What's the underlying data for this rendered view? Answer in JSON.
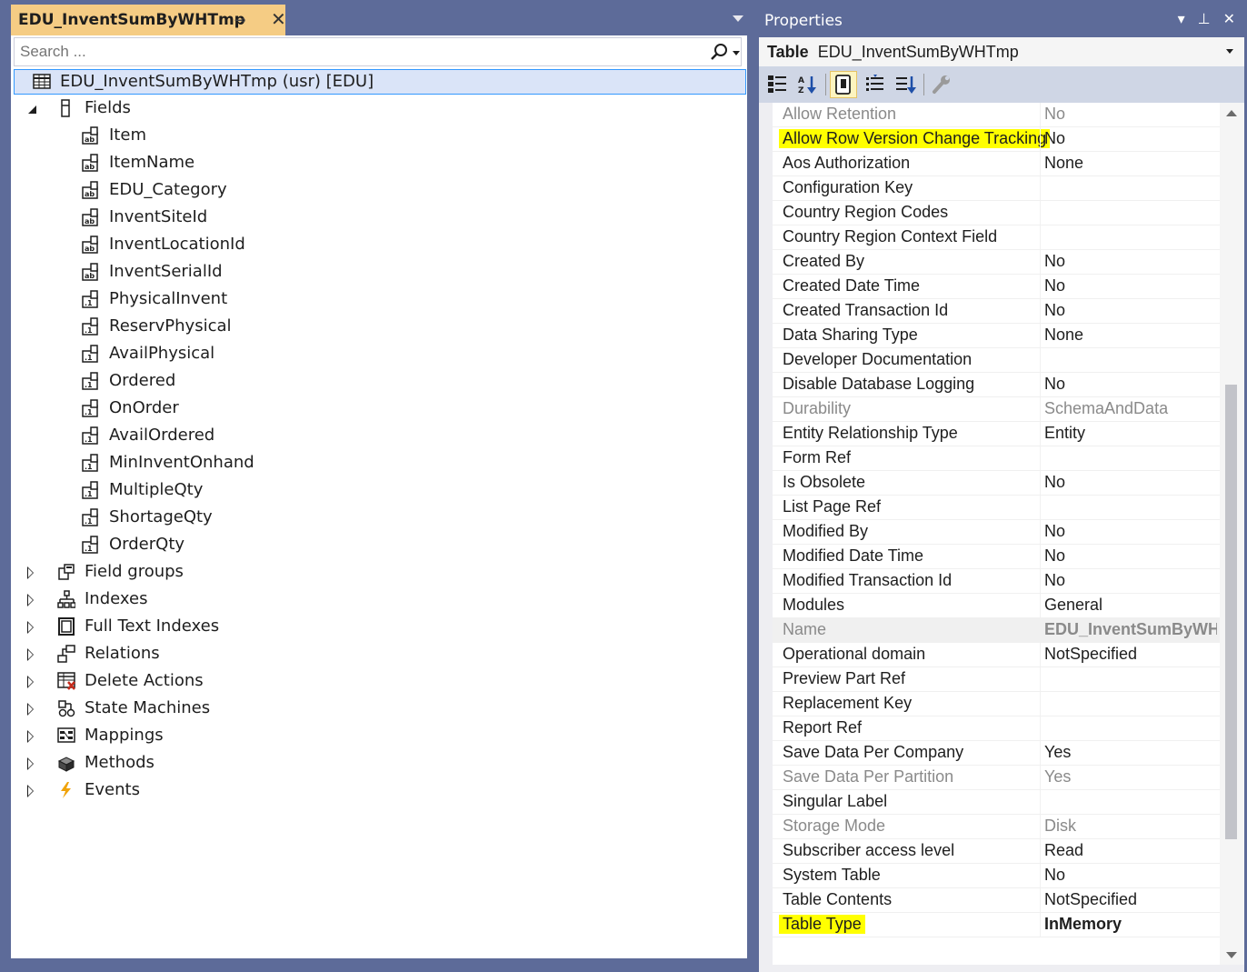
{
  "document_tab": {
    "title": "EDU_InventSumByWHTmp"
  },
  "search": {
    "placeholder": "Search ..."
  },
  "tree": {
    "root_label": "EDU_InventSumByWHTmp (usr) [EDU]",
    "fields_label": "Fields",
    "fields": [
      "Item",
      "ItemName",
      "EDU_Category",
      "InventSiteId",
      "InventLocationId",
      "InventSerialId",
      "PhysicalInvent",
      "ReservPhysical",
      "AvailPhysical",
      "Ordered",
      "OnOrder",
      "AvailOrdered",
      "MinInventOnhand",
      "MultipleQty",
      "ShortageQty",
      "OrderQty"
    ],
    "nodes": [
      "Field groups",
      "Indexes",
      "Full Text Indexes",
      "Relations",
      "Delete Actions",
      "State Machines",
      "Mappings",
      "Methods",
      "Events"
    ]
  },
  "properties": {
    "panel_title": "Properties",
    "object_type": "Table",
    "object_name": "EDU_InventSumByWHTmp",
    "rows": [
      {
        "name": "Allow Retention",
        "value": "No"
      },
      {
        "name": "Allow Row Version Change Tracking",
        "value": "No"
      },
      {
        "name": "Aos Authorization",
        "value": "None"
      },
      {
        "name": "Configuration Key",
        "value": ""
      },
      {
        "name": "Country Region Codes",
        "value": ""
      },
      {
        "name": "Country Region Context Field",
        "value": ""
      },
      {
        "name": "Created By",
        "value": "No"
      },
      {
        "name": "Created Date Time",
        "value": "No"
      },
      {
        "name": "Created Transaction Id",
        "value": "No"
      },
      {
        "name": "Data Sharing Type",
        "value": "None"
      },
      {
        "name": "Developer Documentation",
        "value": ""
      },
      {
        "name": "Disable Database Logging",
        "value": "No"
      },
      {
        "name": "Durability",
        "value": "SchemaAndData"
      },
      {
        "name": "Entity Relationship Type",
        "value": "Entity"
      },
      {
        "name": "Form Ref",
        "value": ""
      },
      {
        "name": "Is Obsolete",
        "value": "No"
      },
      {
        "name": "List Page Ref",
        "value": ""
      },
      {
        "name": "Modified By",
        "value": "No"
      },
      {
        "name": "Modified Date Time",
        "value": "No"
      },
      {
        "name": "Modified Transaction Id",
        "value": "No"
      },
      {
        "name": "Modules",
        "value": "General"
      },
      {
        "name": "Name",
        "value": "EDU_InventSumByWHTmp"
      },
      {
        "name": "Operational domain",
        "value": "NotSpecified"
      },
      {
        "name": "Preview Part Ref",
        "value": ""
      },
      {
        "name": "Replacement Key",
        "value": ""
      },
      {
        "name": "Report Ref",
        "value": ""
      },
      {
        "name": "Save Data Per Company",
        "value": "Yes"
      },
      {
        "name": "Save Data Per Partition",
        "value": "Yes"
      },
      {
        "name": "Singular Label",
        "value": ""
      },
      {
        "name": "Storage Mode",
        "value": "Disk"
      },
      {
        "name": "Subscriber access level",
        "value": "Read"
      },
      {
        "name": "System Table",
        "value": "No"
      },
      {
        "name": "Table Contents",
        "value": "NotSpecified"
      },
      {
        "name": "Table Type",
        "value": "InMemory"
      }
    ]
  },
  "colors": {
    "chrome": "#5d6b99",
    "active_tab": "#f5cc84",
    "highlight": "#ffff00",
    "selection": "#dae4f8",
    "selection_border": "#3399ff"
  }
}
